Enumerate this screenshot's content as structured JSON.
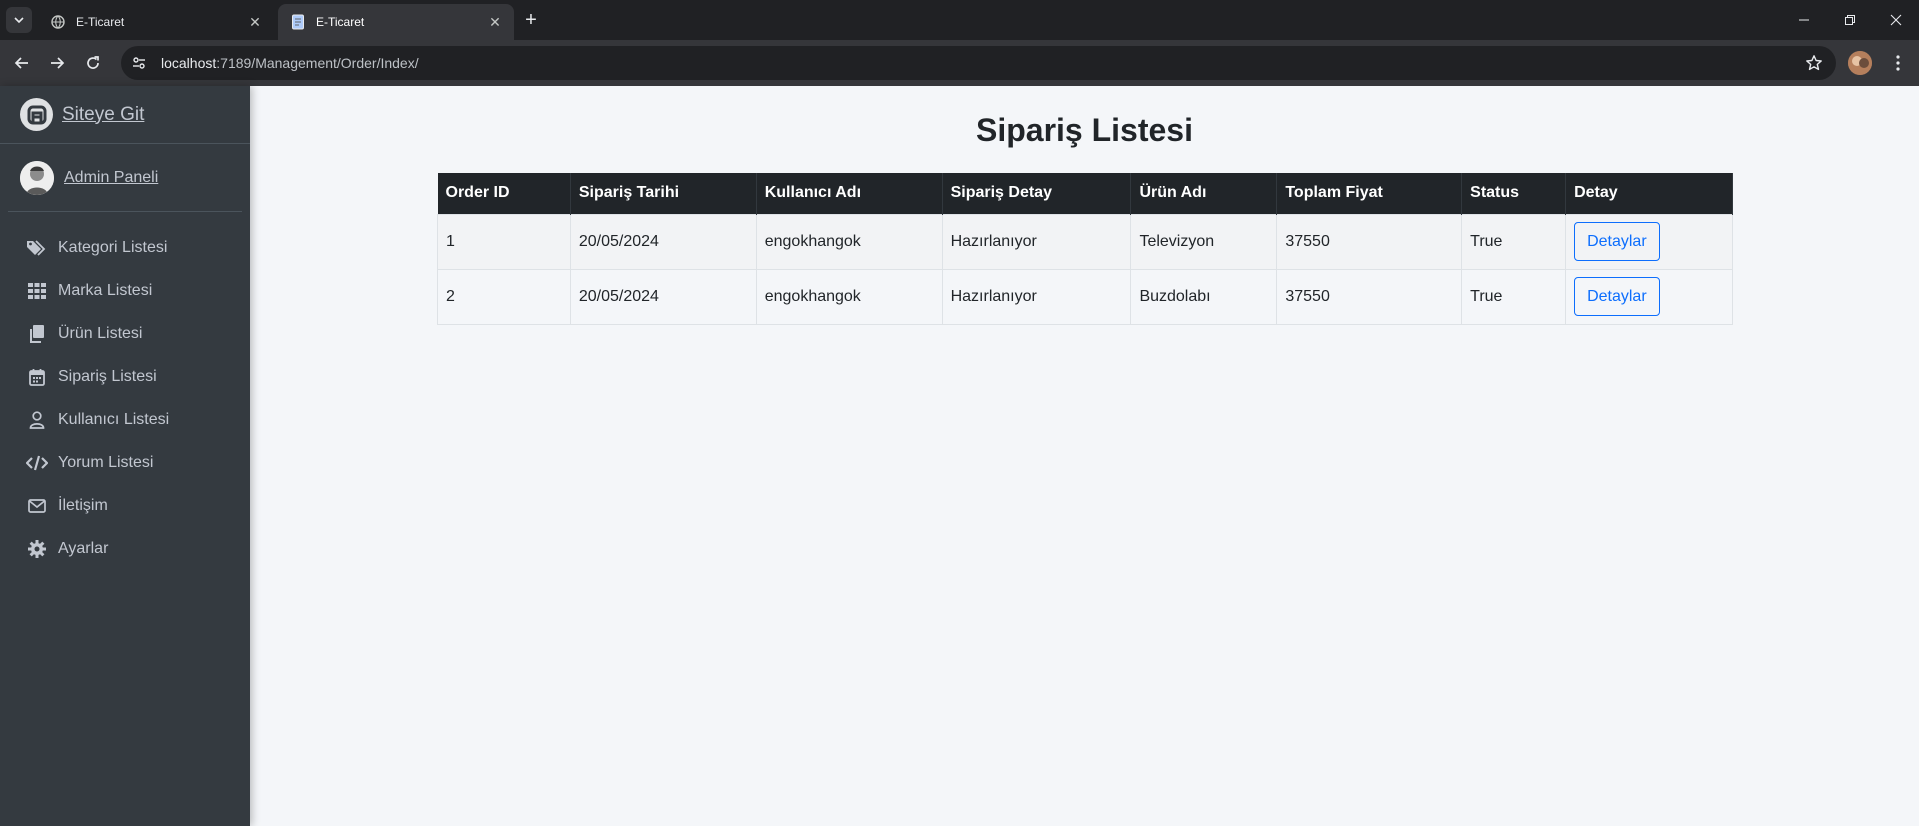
{
  "browser": {
    "tabs": [
      {
        "title": "E-Ticaret",
        "active": false
      },
      {
        "title": "E-Ticaret",
        "active": true
      }
    ],
    "url_host": "localhost",
    "url_path": ":7189/Management/Order/Index/"
  },
  "sidebar": {
    "brand": "Siteye Git",
    "user": "Admin Paneli",
    "items": [
      {
        "label": "Kategori Listesi",
        "icon": "tags-icon"
      },
      {
        "label": "Marka Listesi",
        "icon": "grid-icon"
      },
      {
        "label": "Ürün Listesi",
        "icon": "copy-icon"
      },
      {
        "label": "Sipariş Listesi",
        "icon": "calendar-icon"
      },
      {
        "label": "Kullanıcı Listesi",
        "icon": "user-icon"
      },
      {
        "label": "Yorum Listesi",
        "icon": "code-icon"
      },
      {
        "label": "İletişim",
        "icon": "envelope-icon"
      },
      {
        "label": "Ayarlar",
        "icon": "gear-icon"
      }
    ]
  },
  "main": {
    "title": "Sipariş Listesi",
    "table": {
      "headers": [
        "Order ID",
        "Sipariş Tarihi",
        "Kullanıcı Adı",
        "Sipariş Detay",
        "Ürün Adı",
        "Toplam Fiyat",
        "Status",
        "Detay"
      ],
      "rows": [
        {
          "id": "1",
          "date": "20/05/2024",
          "user": "engokhangok",
          "detail": "Hazırlanıyor",
          "product": "Televizyon",
          "total": "37550",
          "status": "True",
          "button": "Detaylar"
        },
        {
          "id": "2",
          "date": "20/05/2024",
          "user": "engokhangok",
          "detail": "Hazırlanıyor",
          "product": "Buzdolabı",
          "total": "37550",
          "status": "True",
          "button": "Detaylar"
        }
      ]
    }
  },
  "colors": {
    "sidebar_bg": "#343a40",
    "content_bg": "#f4f6f9",
    "table_header_bg": "#212529",
    "button_outline": "#0d6efd"
  }
}
